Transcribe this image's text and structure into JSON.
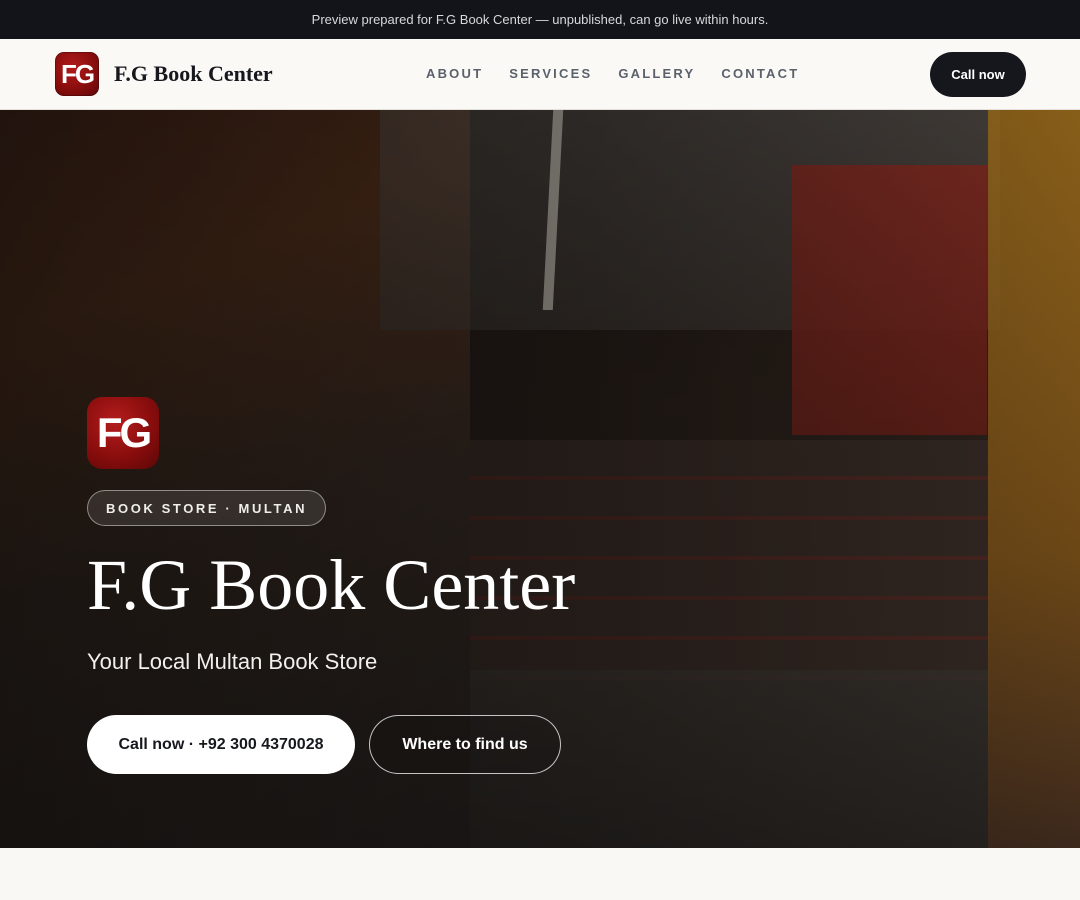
{
  "topbar": {
    "text": "Preview prepared for F.G Book Center — unpublished, can go live within hours."
  },
  "header": {
    "logo_text": "FG",
    "brand_name": "F.G Book Center",
    "nav": [
      "ABOUT",
      "SERVICES",
      "GALLERY",
      "CONTACT"
    ],
    "cta_label": "Call now"
  },
  "hero": {
    "logo_text": "FG",
    "badge": "BOOK STORE · MULTAN",
    "title": "F.G Book Center",
    "subtitle": "Your Local Multan Book Store",
    "primary_button": "Call now · +92 300 4370028",
    "secondary_button": "Where to find us"
  },
  "colors": {
    "topbar_bg": "#121419",
    "brand_red": "#8a0d0d",
    "dark_button": "#15171c",
    "page_bg": "#faf8f4"
  }
}
